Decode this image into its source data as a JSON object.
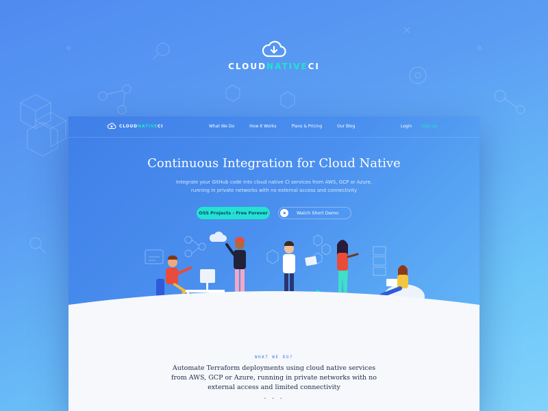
{
  "brand": {
    "part1": "CLOUD",
    "part2": "NATIVE",
    "part3": "CI"
  },
  "nav": {
    "items": [
      "What We Do",
      "How It Works",
      "Plans & Pricing",
      "Our Blog"
    ],
    "login": "Login",
    "signup": "Sign Up"
  },
  "hero": {
    "title": "Continuous Integration for Cloud Native",
    "subtitle_line1": "Integrate your GitHub code into cloud native CI services from AWS, GCP or Azure,",
    "subtitle_line2": "running in private networks with no external access and connectivity",
    "primary_cta": "OSS Projects - Free Forever",
    "secondary_cta": "Watch Short Demo"
  },
  "what_we_do": {
    "eyebrow": "WHAT WE DO?",
    "line1": "Automate Terraform deployments using cloud native services",
    "line2": "from AWS, GCP or Azure, running in private networks with no",
    "line3": "external access and limited connectivity",
    "dots": ". . ."
  },
  "colors": {
    "accent": "#22e3cf",
    "primary": "#3f7fe8",
    "text_dark": "#1f2a44"
  }
}
